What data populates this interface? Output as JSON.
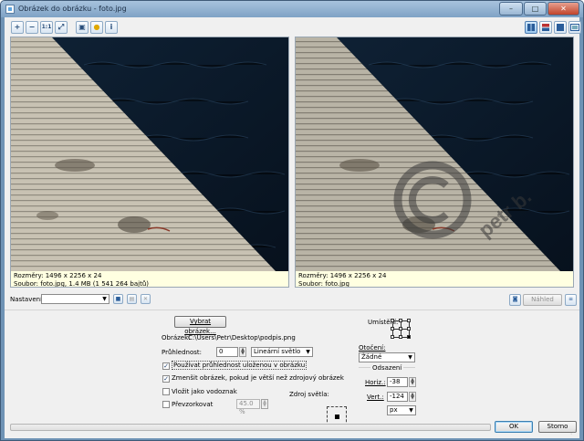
{
  "window": {
    "title": "Obrázek do obrázku - foto.jpg",
    "controls": {
      "minimize": "–",
      "maximize": "□",
      "close": "✕"
    }
  },
  "toolbar": {
    "left_icons": [
      "zoom-in-icon",
      "zoom-out-icon",
      "actual-size-icon",
      "fit-icon",
      "image-open-icon",
      "color-icon",
      "info-icon"
    ],
    "left_labels": [
      "+",
      "−",
      "1:1",
      "⤢",
      "▣",
      "●",
      "i"
    ],
    "right_icons": [
      "layout-side-by-side-icon",
      "layout-stacked-icon",
      "layout-single-icon",
      "layout-fullscreen-icon"
    ]
  },
  "preview_left": {
    "dimensions": "Rozměry: 1496 x 2256 x 24",
    "file": "Soubor: foto.jpg, 1.4 MB (1 541 264 bajtů)"
  },
  "preview_right": {
    "dimensions": "Rozměry: 1496 x 2256 x 24",
    "file": "Soubor: foto.jpg",
    "watermark_text": "petr b."
  },
  "settings_bar": {
    "label": "Nastavení:",
    "value": "",
    "preview_button": "Náhled"
  },
  "form": {
    "choose_image_button": "Vybrat obrázek...",
    "image_label": "Obrázek:",
    "image_path": "C:\\Users\\Petr\\Desktop\\podpis.png",
    "opacity_label": "Průhlednost:",
    "opacity_value": "0",
    "blend_mode": "Lineární světlo",
    "use_saved_opacity": "Používat průhlednost uloženou v obrázku",
    "use_saved_opacity_checked": true,
    "shrink_image": "Zmenšit obrázek, pokud je větší než zdrojový obrázek",
    "shrink_image_checked": true,
    "insert_as_watermark": "Vložit jako vodoznak",
    "insert_as_watermark_checked": false,
    "recolor": "Převzorkovat",
    "recolor_checked": false,
    "recolor_value": "45.0 %",
    "light_source_label": "Zdroj světla:",
    "placement_label": "Umístění:",
    "rotation_label": "Otočení:",
    "rotation_value": "Žádné",
    "offset_label": "Odsazení",
    "horiz_label": "Horiz.:",
    "horiz_value": "-38",
    "vert_label": "Vert.:",
    "vert_value": "-124",
    "unit_value": "px"
  },
  "footer": {
    "progress": 0,
    "ok_button": "OK",
    "cancel_button": "Storno"
  }
}
